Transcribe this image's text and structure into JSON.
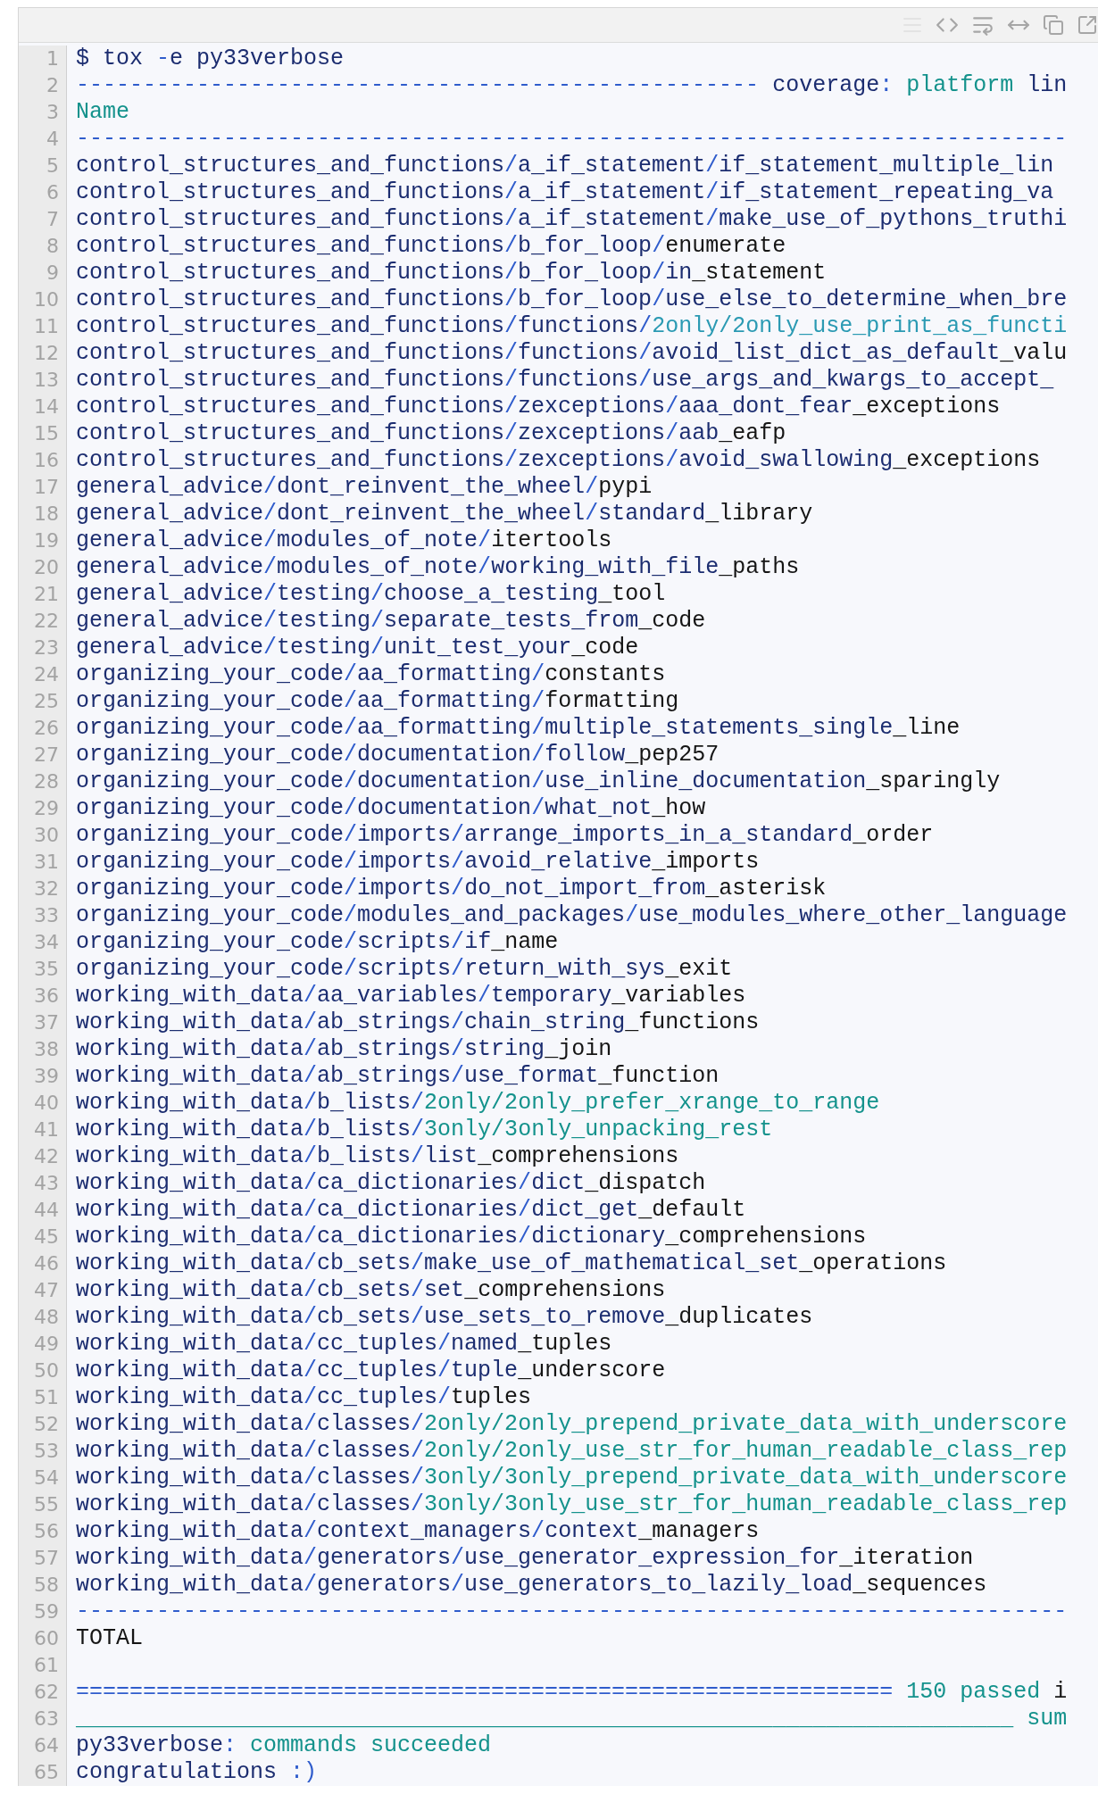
{
  "lines": [
    {
      "number": "1",
      "tokens": [
        {
          "kind": "name",
          "text": "$ tox "
        },
        {
          "kind": "op",
          "text": "-"
        },
        {
          "kind": "name",
          "text": "e py33verbose"
        }
      ]
    },
    {
      "number": "2",
      "tokens": [
        {
          "kind": "op",
          "text": "---------------------------------------------------"
        },
        {
          "kind": "name",
          "text": " coverage"
        },
        {
          "kind": "op",
          "text": ":"
        },
        {
          "kind": "string",
          "text": " platform"
        },
        {
          "kind": "name",
          "text": " lin"
        }
      ]
    },
    {
      "number": "3",
      "tokens": [
        {
          "kind": "string",
          "text": "Name"
        }
      ]
    },
    {
      "number": "4",
      "tokens": [
        {
          "kind": "op",
          "text": "--------------------------------------------------------------------------"
        }
      ]
    },
    {
      "number": "5",
      "tokens": [
        {
          "kind": "name",
          "text": "control_structures_and_functions"
        },
        {
          "kind": "op",
          "text": "/"
        },
        {
          "kind": "name",
          "text": "a_if_statement"
        },
        {
          "kind": "op",
          "text": "/"
        },
        {
          "kind": "name",
          "text": "if_statement_multiple_lin"
        }
      ]
    },
    {
      "number": "6",
      "tokens": [
        {
          "kind": "name",
          "text": "control_structures_and_functions"
        },
        {
          "kind": "op",
          "text": "/"
        },
        {
          "kind": "name",
          "text": "a_if_statement"
        },
        {
          "kind": "op",
          "text": "/"
        },
        {
          "kind": "name",
          "text": "if_statement_repeating_va"
        }
      ]
    },
    {
      "number": "7",
      "tokens": [
        {
          "kind": "name",
          "text": "control_structures_and_functions"
        },
        {
          "kind": "op",
          "text": "/"
        },
        {
          "kind": "name",
          "text": "a_if_statement"
        },
        {
          "kind": "op",
          "text": "/"
        },
        {
          "kind": "name",
          "text": "make_use_of_pythons_truthi"
        }
      ]
    },
    {
      "number": "8",
      "tokens": [
        {
          "kind": "name",
          "text": "control_structures_and_functions"
        },
        {
          "kind": "op",
          "text": "/"
        },
        {
          "kind": "name",
          "text": "b_for_loop"
        },
        {
          "kind": "op",
          "text": "/"
        },
        {
          "kind": "plain",
          "text": "enumerate"
        }
      ]
    },
    {
      "number": "9",
      "tokens": [
        {
          "kind": "name",
          "text": "control_structures_and_functions"
        },
        {
          "kind": "op",
          "text": "/"
        },
        {
          "kind": "name",
          "text": "b_for_loop"
        },
        {
          "kind": "op",
          "text": "/"
        },
        {
          "kind": "name",
          "text": "in"
        },
        {
          "kind": "plain",
          "text": "_statement"
        }
      ]
    },
    {
      "number": "10",
      "tokens": [
        {
          "kind": "name",
          "text": "control_structures_and_functions"
        },
        {
          "kind": "op",
          "text": "/"
        },
        {
          "kind": "name",
          "text": "b_for_loop"
        },
        {
          "kind": "op",
          "text": "/"
        },
        {
          "kind": "name",
          "text": "use_else_to_determine_when_bre"
        }
      ]
    },
    {
      "number": "11",
      "tokens": [
        {
          "kind": "name",
          "text": "control_structures_and_functions"
        },
        {
          "kind": "op",
          "text": "/"
        },
        {
          "kind": "name",
          "text": "functions"
        },
        {
          "kind": "op",
          "text": "/"
        },
        {
          "kind": "builtin",
          "text": "2only/2only_use_print_as_functi"
        }
      ]
    },
    {
      "number": "12",
      "tokens": [
        {
          "kind": "name",
          "text": "control_structures_and_functions"
        },
        {
          "kind": "op",
          "text": "/"
        },
        {
          "kind": "name",
          "text": "functions"
        },
        {
          "kind": "op",
          "text": "/"
        },
        {
          "kind": "name",
          "text": "avoid_list_dict_as_default"
        },
        {
          "kind": "plain",
          "text": "_valu"
        }
      ]
    },
    {
      "number": "13",
      "tokens": [
        {
          "kind": "name",
          "text": "control_structures_and_functions"
        },
        {
          "kind": "op",
          "text": "/"
        },
        {
          "kind": "name",
          "text": "functions"
        },
        {
          "kind": "op",
          "text": "/"
        },
        {
          "kind": "name",
          "text": "use_args_and_kwargs_to_accept_"
        }
      ]
    },
    {
      "number": "14",
      "tokens": [
        {
          "kind": "name",
          "text": "control_structures_and_functions"
        },
        {
          "kind": "op",
          "text": "/"
        },
        {
          "kind": "name",
          "text": "zexceptions"
        },
        {
          "kind": "op",
          "text": "/"
        },
        {
          "kind": "name",
          "text": "aaa_dont_fear"
        },
        {
          "kind": "plain",
          "text": "_exceptions"
        }
      ]
    },
    {
      "number": "15",
      "tokens": [
        {
          "kind": "name",
          "text": "control_structures_and_functions"
        },
        {
          "kind": "op",
          "text": "/"
        },
        {
          "kind": "name",
          "text": "zexceptions"
        },
        {
          "kind": "op",
          "text": "/"
        },
        {
          "kind": "name",
          "text": "aab"
        },
        {
          "kind": "plain",
          "text": "_eafp"
        }
      ]
    },
    {
      "number": "16",
      "tokens": [
        {
          "kind": "name",
          "text": "control_structures_and_functions"
        },
        {
          "kind": "op",
          "text": "/"
        },
        {
          "kind": "name",
          "text": "zexceptions"
        },
        {
          "kind": "op",
          "text": "/"
        },
        {
          "kind": "name",
          "text": "avoid_swallowing"
        },
        {
          "kind": "plain",
          "text": "_exceptions"
        }
      ]
    },
    {
      "number": "17",
      "tokens": [
        {
          "kind": "name",
          "text": "general_advice"
        },
        {
          "kind": "op",
          "text": "/"
        },
        {
          "kind": "name",
          "text": "dont_reinvent_the_wheel"
        },
        {
          "kind": "op",
          "text": "/"
        },
        {
          "kind": "plain",
          "text": "pypi"
        }
      ]
    },
    {
      "number": "18",
      "tokens": [
        {
          "kind": "name",
          "text": "general_advice"
        },
        {
          "kind": "op",
          "text": "/"
        },
        {
          "kind": "name",
          "text": "dont_reinvent_the_wheel"
        },
        {
          "kind": "op",
          "text": "/"
        },
        {
          "kind": "name",
          "text": "standard"
        },
        {
          "kind": "plain",
          "text": "_library"
        }
      ]
    },
    {
      "number": "19",
      "tokens": [
        {
          "kind": "name",
          "text": "general_advice"
        },
        {
          "kind": "op",
          "text": "/"
        },
        {
          "kind": "name",
          "text": "modules_of_note"
        },
        {
          "kind": "op",
          "text": "/"
        },
        {
          "kind": "plain",
          "text": "itertools"
        }
      ]
    },
    {
      "number": "20",
      "tokens": [
        {
          "kind": "name",
          "text": "general_advice"
        },
        {
          "kind": "op",
          "text": "/"
        },
        {
          "kind": "name",
          "text": "modules_of_note"
        },
        {
          "kind": "op",
          "text": "/"
        },
        {
          "kind": "name",
          "text": "working_with_file"
        },
        {
          "kind": "plain",
          "text": "_paths"
        }
      ]
    },
    {
      "number": "21",
      "tokens": [
        {
          "kind": "name",
          "text": "general_advice"
        },
        {
          "kind": "op",
          "text": "/"
        },
        {
          "kind": "name",
          "text": "testing"
        },
        {
          "kind": "op",
          "text": "/"
        },
        {
          "kind": "name",
          "text": "choose_a_testing"
        },
        {
          "kind": "plain",
          "text": "_tool"
        }
      ]
    },
    {
      "number": "22",
      "tokens": [
        {
          "kind": "name",
          "text": "general_advice"
        },
        {
          "kind": "op",
          "text": "/"
        },
        {
          "kind": "name",
          "text": "testing"
        },
        {
          "kind": "op",
          "text": "/"
        },
        {
          "kind": "name",
          "text": "separate_tests_from"
        },
        {
          "kind": "plain",
          "text": "_code"
        }
      ]
    },
    {
      "number": "23",
      "tokens": [
        {
          "kind": "name",
          "text": "general_advice"
        },
        {
          "kind": "op",
          "text": "/"
        },
        {
          "kind": "name",
          "text": "testing"
        },
        {
          "kind": "op",
          "text": "/"
        },
        {
          "kind": "name",
          "text": "unit_test_your"
        },
        {
          "kind": "plain",
          "text": "_code"
        }
      ]
    },
    {
      "number": "24",
      "tokens": [
        {
          "kind": "name",
          "text": "organizing_your_code"
        },
        {
          "kind": "op",
          "text": "/"
        },
        {
          "kind": "name",
          "text": "aa_formatting"
        },
        {
          "kind": "op",
          "text": "/"
        },
        {
          "kind": "plain",
          "text": "constants"
        }
      ]
    },
    {
      "number": "25",
      "tokens": [
        {
          "kind": "name",
          "text": "organizing_your_code"
        },
        {
          "kind": "op",
          "text": "/"
        },
        {
          "kind": "name",
          "text": "aa_formatting"
        },
        {
          "kind": "op",
          "text": "/"
        },
        {
          "kind": "plain",
          "text": "formatting"
        }
      ]
    },
    {
      "number": "26",
      "tokens": [
        {
          "kind": "name",
          "text": "organizing_your_code"
        },
        {
          "kind": "op",
          "text": "/"
        },
        {
          "kind": "name",
          "text": "aa_formatting"
        },
        {
          "kind": "op",
          "text": "/"
        },
        {
          "kind": "name",
          "text": "multiple_statements_single"
        },
        {
          "kind": "plain",
          "text": "_line"
        }
      ]
    },
    {
      "number": "27",
      "tokens": [
        {
          "kind": "name",
          "text": "organizing_your_code"
        },
        {
          "kind": "op",
          "text": "/"
        },
        {
          "kind": "name",
          "text": "documentation"
        },
        {
          "kind": "op",
          "text": "/"
        },
        {
          "kind": "name",
          "text": "follow"
        },
        {
          "kind": "plain",
          "text": "_pep257"
        }
      ]
    },
    {
      "number": "28",
      "tokens": [
        {
          "kind": "name",
          "text": "organizing_your_code"
        },
        {
          "kind": "op",
          "text": "/"
        },
        {
          "kind": "name",
          "text": "documentation"
        },
        {
          "kind": "op",
          "text": "/"
        },
        {
          "kind": "name",
          "text": "use_inline_documentation"
        },
        {
          "kind": "plain",
          "text": "_sparingly"
        }
      ]
    },
    {
      "number": "29",
      "tokens": [
        {
          "kind": "name",
          "text": "organizing_your_code"
        },
        {
          "kind": "op",
          "text": "/"
        },
        {
          "kind": "name",
          "text": "documentation"
        },
        {
          "kind": "op",
          "text": "/"
        },
        {
          "kind": "name",
          "text": "what_not"
        },
        {
          "kind": "plain",
          "text": "_how"
        }
      ]
    },
    {
      "number": "30",
      "tokens": [
        {
          "kind": "name",
          "text": "organizing_your_code"
        },
        {
          "kind": "op",
          "text": "/"
        },
        {
          "kind": "name",
          "text": "imports"
        },
        {
          "kind": "op",
          "text": "/"
        },
        {
          "kind": "name",
          "text": "arrange_imports_in_a_standard"
        },
        {
          "kind": "plain",
          "text": "_order"
        }
      ]
    },
    {
      "number": "31",
      "tokens": [
        {
          "kind": "name",
          "text": "organizing_your_code"
        },
        {
          "kind": "op",
          "text": "/"
        },
        {
          "kind": "name",
          "text": "imports"
        },
        {
          "kind": "op",
          "text": "/"
        },
        {
          "kind": "name",
          "text": "avoid_relative"
        },
        {
          "kind": "plain",
          "text": "_imports"
        }
      ]
    },
    {
      "number": "32",
      "tokens": [
        {
          "kind": "name",
          "text": "organizing_your_code"
        },
        {
          "kind": "op",
          "text": "/"
        },
        {
          "kind": "name",
          "text": "imports"
        },
        {
          "kind": "op",
          "text": "/"
        },
        {
          "kind": "name",
          "text": "do_not_import_from"
        },
        {
          "kind": "plain",
          "text": "_asterisk"
        }
      ]
    },
    {
      "number": "33",
      "tokens": [
        {
          "kind": "name",
          "text": "organizing_your_code"
        },
        {
          "kind": "op",
          "text": "/"
        },
        {
          "kind": "name",
          "text": "modules_and_packages"
        },
        {
          "kind": "op",
          "text": "/"
        },
        {
          "kind": "name",
          "text": "use_modules_where_other_language"
        }
      ]
    },
    {
      "number": "34",
      "tokens": [
        {
          "kind": "name",
          "text": "organizing_your_code"
        },
        {
          "kind": "op",
          "text": "/"
        },
        {
          "kind": "name",
          "text": "scripts"
        },
        {
          "kind": "op",
          "text": "/"
        },
        {
          "kind": "name",
          "text": "if"
        },
        {
          "kind": "plain",
          "text": "_name"
        }
      ]
    },
    {
      "number": "35",
      "tokens": [
        {
          "kind": "name",
          "text": "organizing_your_code"
        },
        {
          "kind": "op",
          "text": "/"
        },
        {
          "kind": "name",
          "text": "scripts"
        },
        {
          "kind": "op",
          "text": "/"
        },
        {
          "kind": "name",
          "text": "return_with_sys"
        },
        {
          "kind": "plain",
          "text": "_exit"
        }
      ]
    },
    {
      "number": "36",
      "tokens": [
        {
          "kind": "name",
          "text": "working_with_data"
        },
        {
          "kind": "op",
          "text": "/"
        },
        {
          "kind": "name",
          "text": "aa_variables"
        },
        {
          "kind": "op",
          "text": "/"
        },
        {
          "kind": "name",
          "text": "temporary"
        },
        {
          "kind": "plain",
          "text": "_variables"
        }
      ]
    },
    {
      "number": "37",
      "tokens": [
        {
          "kind": "name",
          "text": "working_with_data"
        },
        {
          "kind": "op",
          "text": "/"
        },
        {
          "kind": "name",
          "text": "ab_strings"
        },
        {
          "kind": "op",
          "text": "/"
        },
        {
          "kind": "name",
          "text": "chain_string"
        },
        {
          "kind": "plain",
          "text": "_functions"
        }
      ]
    },
    {
      "number": "38",
      "tokens": [
        {
          "kind": "name",
          "text": "working_with_data"
        },
        {
          "kind": "op",
          "text": "/"
        },
        {
          "kind": "name",
          "text": "ab_strings"
        },
        {
          "kind": "op",
          "text": "/"
        },
        {
          "kind": "name",
          "text": "string"
        },
        {
          "kind": "plain",
          "text": "_join"
        }
      ]
    },
    {
      "number": "39",
      "tokens": [
        {
          "kind": "name",
          "text": "working_with_data"
        },
        {
          "kind": "op",
          "text": "/"
        },
        {
          "kind": "name",
          "text": "ab_strings"
        },
        {
          "kind": "op",
          "text": "/"
        },
        {
          "kind": "name",
          "text": "use_format"
        },
        {
          "kind": "plain",
          "text": "_function"
        }
      ]
    },
    {
      "number": "40",
      "tokens": [
        {
          "kind": "name",
          "text": "working_with_data"
        },
        {
          "kind": "op",
          "text": "/"
        },
        {
          "kind": "name",
          "text": "b_lists"
        },
        {
          "kind": "op",
          "text": "/"
        },
        {
          "kind": "string",
          "text": "2only/2only_prefer_xrange_to_range"
        }
      ]
    },
    {
      "number": "41",
      "tokens": [
        {
          "kind": "name",
          "text": "working_with_data"
        },
        {
          "kind": "op",
          "text": "/"
        },
        {
          "kind": "name",
          "text": "b_lists"
        },
        {
          "kind": "op",
          "text": "/"
        },
        {
          "kind": "string",
          "text": "3only/3only_unpacking_rest"
        }
      ]
    },
    {
      "number": "42",
      "tokens": [
        {
          "kind": "name",
          "text": "working_with_data"
        },
        {
          "kind": "op",
          "text": "/"
        },
        {
          "kind": "name",
          "text": "b_lists"
        },
        {
          "kind": "op",
          "text": "/"
        },
        {
          "kind": "name",
          "text": "list"
        },
        {
          "kind": "plain",
          "text": "_comprehensions"
        }
      ]
    },
    {
      "number": "43",
      "tokens": [
        {
          "kind": "name",
          "text": "working_with_data"
        },
        {
          "kind": "op",
          "text": "/"
        },
        {
          "kind": "name",
          "text": "ca_dictionaries"
        },
        {
          "kind": "op",
          "text": "/"
        },
        {
          "kind": "name",
          "text": "dict"
        },
        {
          "kind": "plain",
          "text": "_dispatch"
        }
      ]
    },
    {
      "number": "44",
      "tokens": [
        {
          "kind": "name",
          "text": "working_with_data"
        },
        {
          "kind": "op",
          "text": "/"
        },
        {
          "kind": "name",
          "text": "ca_dictionaries"
        },
        {
          "kind": "op",
          "text": "/"
        },
        {
          "kind": "name",
          "text": "dict_get"
        },
        {
          "kind": "plain",
          "text": "_default"
        }
      ]
    },
    {
      "number": "45",
      "tokens": [
        {
          "kind": "name",
          "text": "working_with_data"
        },
        {
          "kind": "op",
          "text": "/"
        },
        {
          "kind": "name",
          "text": "ca_dictionaries"
        },
        {
          "kind": "op",
          "text": "/"
        },
        {
          "kind": "name",
          "text": "dictionary"
        },
        {
          "kind": "plain",
          "text": "_comprehensions"
        }
      ]
    },
    {
      "number": "46",
      "tokens": [
        {
          "kind": "name",
          "text": "working_with_data"
        },
        {
          "kind": "op",
          "text": "/"
        },
        {
          "kind": "name",
          "text": "cb_sets"
        },
        {
          "kind": "op",
          "text": "/"
        },
        {
          "kind": "name",
          "text": "make_use_of_mathematical_set"
        },
        {
          "kind": "plain",
          "text": "_operations"
        }
      ]
    },
    {
      "number": "47",
      "tokens": [
        {
          "kind": "name",
          "text": "working_with_data"
        },
        {
          "kind": "op",
          "text": "/"
        },
        {
          "kind": "name",
          "text": "cb_sets"
        },
        {
          "kind": "op",
          "text": "/"
        },
        {
          "kind": "name",
          "text": "set"
        },
        {
          "kind": "plain",
          "text": "_comprehensions"
        }
      ]
    },
    {
      "number": "48",
      "tokens": [
        {
          "kind": "name",
          "text": "working_with_data"
        },
        {
          "kind": "op",
          "text": "/"
        },
        {
          "kind": "name",
          "text": "cb_sets"
        },
        {
          "kind": "op",
          "text": "/"
        },
        {
          "kind": "name",
          "text": "use_sets_to_remove"
        },
        {
          "kind": "plain",
          "text": "_duplicates"
        }
      ]
    },
    {
      "number": "49",
      "tokens": [
        {
          "kind": "name",
          "text": "working_with_data"
        },
        {
          "kind": "op",
          "text": "/"
        },
        {
          "kind": "name",
          "text": "cc_tuples"
        },
        {
          "kind": "op",
          "text": "/"
        },
        {
          "kind": "name",
          "text": "named"
        },
        {
          "kind": "plain",
          "text": "_tuples"
        }
      ]
    },
    {
      "number": "50",
      "tokens": [
        {
          "kind": "name",
          "text": "working_with_data"
        },
        {
          "kind": "op",
          "text": "/"
        },
        {
          "kind": "name",
          "text": "cc_tuples"
        },
        {
          "kind": "op",
          "text": "/"
        },
        {
          "kind": "name",
          "text": "tuple"
        },
        {
          "kind": "plain",
          "text": "_underscore"
        }
      ]
    },
    {
      "number": "51",
      "tokens": [
        {
          "kind": "name",
          "text": "working_with_data"
        },
        {
          "kind": "op",
          "text": "/"
        },
        {
          "kind": "name",
          "text": "cc_tuples"
        },
        {
          "kind": "op",
          "text": "/"
        },
        {
          "kind": "plain",
          "text": "tuples"
        }
      ]
    },
    {
      "number": "52",
      "tokens": [
        {
          "kind": "name",
          "text": "working_with_data"
        },
        {
          "kind": "op",
          "text": "/"
        },
        {
          "kind": "name",
          "text": "classes"
        },
        {
          "kind": "op",
          "text": "/"
        },
        {
          "kind": "string",
          "text": "2only/2only_prepend_private_data_with_underscore"
        }
      ]
    },
    {
      "number": "53",
      "tokens": [
        {
          "kind": "name",
          "text": "working_with_data"
        },
        {
          "kind": "op",
          "text": "/"
        },
        {
          "kind": "name",
          "text": "classes"
        },
        {
          "kind": "op",
          "text": "/"
        },
        {
          "kind": "string",
          "text": "2only/2only_use_str_for_human_readable_class_rep"
        }
      ]
    },
    {
      "number": "54",
      "tokens": [
        {
          "kind": "name",
          "text": "working_with_data"
        },
        {
          "kind": "op",
          "text": "/"
        },
        {
          "kind": "name",
          "text": "classes"
        },
        {
          "kind": "op",
          "text": "/"
        },
        {
          "kind": "string",
          "text": "3only/3only_prepend_private_data_with_underscore"
        }
      ]
    },
    {
      "number": "55",
      "tokens": [
        {
          "kind": "name",
          "text": "working_with_data"
        },
        {
          "kind": "op",
          "text": "/"
        },
        {
          "kind": "name",
          "text": "classes"
        },
        {
          "kind": "op",
          "text": "/"
        },
        {
          "kind": "string",
          "text": "3only/3only_use_str_for_human_readable_class_rep"
        }
      ]
    },
    {
      "number": "56",
      "tokens": [
        {
          "kind": "name",
          "text": "working_with_data"
        },
        {
          "kind": "op",
          "text": "/"
        },
        {
          "kind": "name",
          "text": "context_managers"
        },
        {
          "kind": "op",
          "text": "/"
        },
        {
          "kind": "name",
          "text": "context"
        },
        {
          "kind": "plain",
          "text": "_managers"
        }
      ]
    },
    {
      "number": "57",
      "tokens": [
        {
          "kind": "name",
          "text": "working_with_data"
        },
        {
          "kind": "op",
          "text": "/"
        },
        {
          "kind": "name",
          "text": "generators"
        },
        {
          "kind": "op",
          "text": "/"
        },
        {
          "kind": "name",
          "text": "use_generator_expression_for"
        },
        {
          "kind": "plain",
          "text": "_iteration"
        }
      ]
    },
    {
      "number": "58",
      "tokens": [
        {
          "kind": "name",
          "text": "working_with_data"
        },
        {
          "kind": "op",
          "text": "/"
        },
        {
          "kind": "name",
          "text": "generators"
        },
        {
          "kind": "op",
          "text": "/"
        },
        {
          "kind": "name",
          "text": "use_generators_to_lazily_load"
        },
        {
          "kind": "plain",
          "text": "_sequences"
        }
      ]
    },
    {
      "number": "59",
      "tokens": [
        {
          "kind": "op",
          "text": "--------------------------------------------------------------------------"
        }
      ]
    },
    {
      "number": "60",
      "tokens": [
        {
          "kind": "plain",
          "text": "TOTAL"
        }
      ]
    },
    {
      "number": "61"
    },
    {
      "number": "62",
      "tokens": [
        {
          "kind": "op",
          "text": "============================================================="
        },
        {
          "kind": "string",
          "text": " 150 passed"
        },
        {
          "kind": "plain",
          "text": " i"
        }
      ]
    },
    {
      "number": "63",
      "tokens": [
        {
          "kind": "string",
          "text": "______________________________________________________________________ sum"
        }
      ]
    },
    {
      "number": "64",
      "tokens": [
        {
          "kind": "name",
          "text": "py33verbose"
        },
        {
          "kind": "op",
          "text": ":"
        },
        {
          "kind": "string",
          "text": " commands succeeded"
        }
      ]
    },
    {
      "number": "65",
      "tokens": [
        {
          "kind": "name",
          "text": "congratulations "
        },
        {
          "kind": "op",
          "text": ":)"
        }
      ]
    }
  ]
}
